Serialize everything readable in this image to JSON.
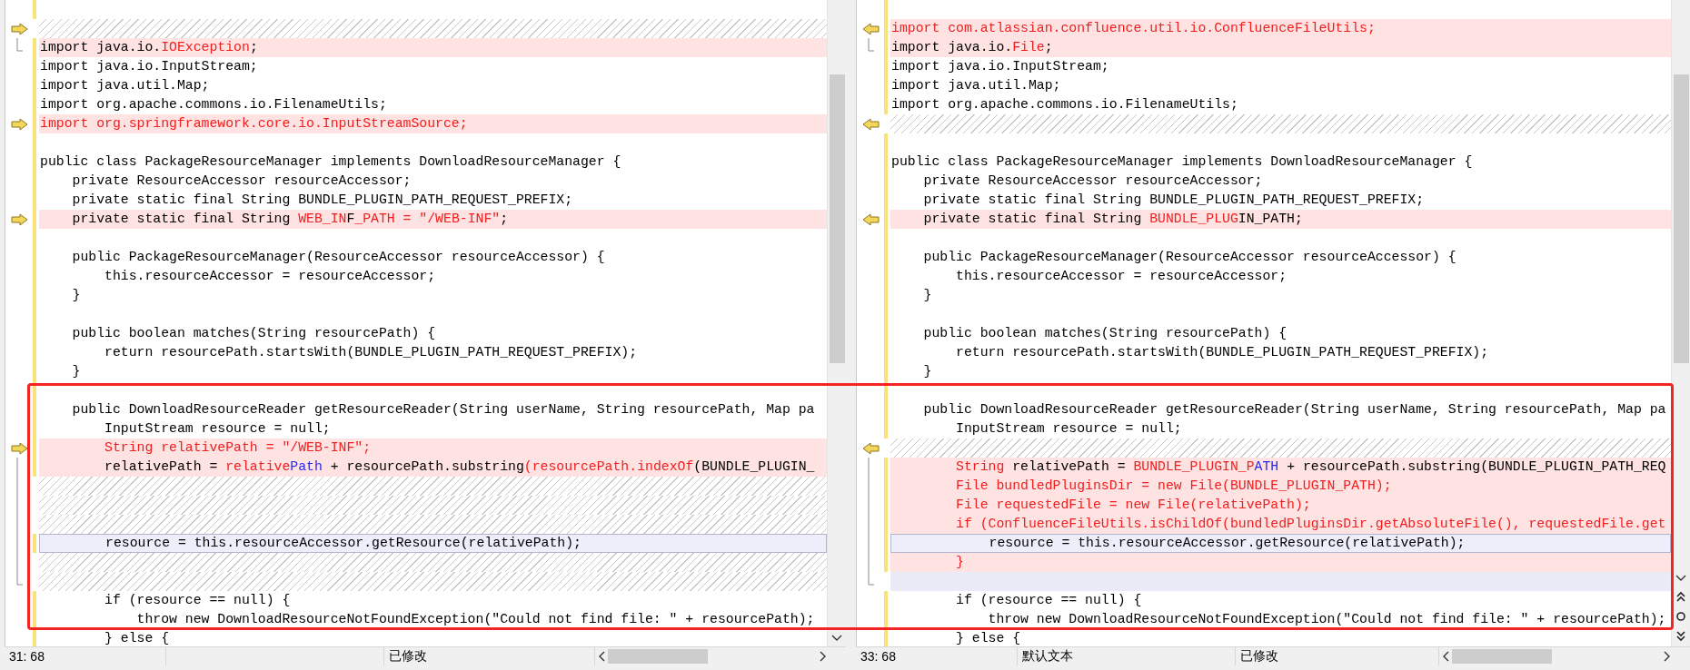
{
  "panes": [
    {
      "kind": "left",
      "lines": [
        {
          "kind": "empty",
          "arrow": false,
          "bracket": false
        },
        {
          "kind": "gap",
          "arrow": true,
          "bracket": false
        },
        {
          "kind": "changed",
          "arrow": false,
          "bracket": true,
          "segments": [
            {
              "text": "import java.io.",
              "color": "#000000"
            },
            {
              "text": "IOException",
              "color": "#f01e1e"
            },
            {
              "text": ";",
              "color": "#000000"
            }
          ]
        },
        {
          "kind": "same",
          "arrow": false,
          "bracket": false,
          "segments": [
            {
              "text": "import java.io.InputStream;",
              "color": "#000000"
            }
          ]
        },
        {
          "kind": "same",
          "arrow": false,
          "bracket": false,
          "segments": [
            {
              "text": "import java.util.Map;",
              "color": "#000000"
            }
          ]
        },
        {
          "kind": "same",
          "arrow": false,
          "bracket": false,
          "segments": [
            {
              "text": "import org.apache.commons.io.FilenameUtils;",
              "color": "#000000"
            }
          ]
        },
        {
          "kind": "changed",
          "arrow": true,
          "bracket": false,
          "segments": [
            {
              "text": "import org.springframework.core.io.InputStreamSource;",
              "color": "#f01e1e"
            }
          ]
        },
        {
          "kind": "empty",
          "arrow": false,
          "bracket": false
        },
        {
          "kind": "same",
          "arrow": false,
          "bracket": false,
          "segments": [
            {
              "text": "public class PackageResourceManager implements DownloadResourceManager {",
              "color": "#000000"
            }
          ]
        },
        {
          "kind": "same",
          "arrow": false,
          "bracket": false,
          "segments": [
            {
              "text": "    private ResourceAccessor resourceAccessor;",
              "color": "#000000"
            }
          ]
        },
        {
          "kind": "same",
          "arrow": false,
          "bracket": false,
          "segments": [
            {
              "text": "    private static final String BUNDLE_PLUGIN_PATH_REQUEST_PREFIX;",
              "color": "#000000"
            }
          ]
        },
        {
          "kind": "changed",
          "arrow": true,
          "bracket": false,
          "segments": [
            {
              "text": "    private static final String ",
              "color": "#000000"
            },
            {
              "text": "WEB_IN",
              "color": "#f01e1e"
            },
            {
              "text": "F",
              "color": "#000000"
            },
            {
              "text": "_PATH = \"/WEB-INF\"",
              "color": "#f01e1e"
            },
            {
              "text": ";",
              "color": "#000000"
            }
          ]
        },
        {
          "kind": "empty",
          "arrow": false,
          "bracket": false
        },
        {
          "kind": "same",
          "arrow": false,
          "bracket": false,
          "segments": [
            {
              "text": "    public PackageResourceManager(ResourceAccessor resourceAccessor) {",
              "color": "#000000"
            }
          ]
        },
        {
          "kind": "same",
          "arrow": false,
          "bracket": false,
          "segments": [
            {
              "text": "        this.resourceAccessor = resourceAccessor;",
              "color": "#000000"
            }
          ]
        },
        {
          "kind": "same",
          "arrow": false,
          "bracket": false,
          "segments": [
            {
              "text": "    }",
              "color": "#000000"
            }
          ]
        },
        {
          "kind": "empty",
          "arrow": false,
          "bracket": false
        },
        {
          "kind": "same",
          "arrow": false,
          "bracket": false,
          "segments": [
            {
              "text": "    public boolean matches(String resourcePath) {",
              "color": "#000000"
            }
          ]
        },
        {
          "kind": "same",
          "arrow": false,
          "bracket": false,
          "segments": [
            {
              "text": "        return resourcePath.startsWith(BUNDLE_PLUGIN_PATH_REQUEST_PREFIX);",
              "color": "#000000"
            }
          ]
        },
        {
          "kind": "same",
          "arrow": false,
          "bracket": false,
          "segments": [
            {
              "text": "    }",
              "color": "#000000"
            }
          ]
        },
        {
          "kind": "empty",
          "arrow": false,
          "bracket": false
        },
        {
          "kind": "same",
          "arrow": false,
          "bracket": false,
          "segments": [
            {
              "text": "    public DownloadResourceReader getResourceReader(String userName, String resourcePath, Map pa",
              "color": "#000000"
            }
          ]
        },
        {
          "kind": "same",
          "arrow": false,
          "bracket": false,
          "segments": [
            {
              "text": "        InputStream resource = null;",
              "color": "#000000"
            }
          ]
        },
        {
          "kind": "changed",
          "arrow": true,
          "bracket": false,
          "segments": [
            {
              "text": "        String relativePath = \"/WEB-INF\";",
              "color": "#f01e1e"
            }
          ]
        },
        {
          "kind": "changed",
          "arrow": false,
          "bracket": true,
          "segments": [
            {
              "text": "        relativePath = ",
              "color": "#000000"
            },
            {
              "text": "relative",
              "color": "#f01e1e"
            },
            {
              "text": "Path",
              "color": "#2828e6"
            },
            {
              "text": " + resourcePath.substring",
              "color": "#000000"
            },
            {
              "text": "(resourcePath.indexOf",
              "color": "#f01e1e"
            },
            {
              "text": "(BUNDLE_PLUGIN_",
              "color": "#000000"
            }
          ]
        },
        {
          "kind": "gap",
          "arrow": false,
          "bracket": true
        },
        {
          "kind": "gap",
          "arrow": false,
          "bracket": true
        },
        {
          "kind": "gap",
          "arrow": false,
          "bracket": true
        },
        {
          "kind": "current",
          "arrow": false,
          "bracket": true,
          "segments": [
            {
              "text": "        resource = this.resourceAccessor.getResource(relativePath);",
              "color": "#000000"
            }
          ]
        },
        {
          "kind": "gap",
          "arrow": false,
          "bracket": true
        },
        {
          "kind": "gap",
          "arrow": false,
          "bracket": true
        },
        {
          "kind": "same",
          "arrow": false,
          "bracket": false,
          "segments": [
            {
              "text": "        if (resource == null) {",
              "color": "#000000"
            }
          ]
        },
        {
          "kind": "same",
          "arrow": false,
          "bracket": false,
          "segments": [
            {
              "text": "            throw new DownloadResourceNotFoundException(\"Could not find file: \" + resourcePath);",
              "color": "#000000"
            }
          ]
        },
        {
          "kind": "same",
          "arrow": false,
          "bracket": false,
          "segments": [
            {
              "text": "        } else {",
              "color": "#000000"
            }
          ]
        }
      ],
      "status": {
        "position": "31: 68",
        "modified": "已修改"
      }
    },
    {
      "kind": "right",
      "lines": [
        {
          "kind": "empty",
          "arrow": false,
          "bracket": false
        },
        {
          "kind": "changed",
          "arrow": true,
          "bracket": false,
          "segments": [
            {
              "text": "import com.atlassian.confluence.util.io.ConfluenceFileUtils;",
              "color": "#f01e1e"
            }
          ]
        },
        {
          "kind": "changed",
          "arrow": false,
          "bracket": true,
          "segments": [
            {
              "text": "import java.io.",
              "color": "#000000"
            },
            {
              "text": "File",
              "color": "#f01e1e"
            },
            {
              "text": ";",
              "color": "#000000"
            }
          ]
        },
        {
          "kind": "same",
          "arrow": false,
          "bracket": false,
          "segments": [
            {
              "text": "import java.io.InputStream;",
              "color": "#000000"
            }
          ]
        },
        {
          "kind": "same",
          "arrow": false,
          "bracket": false,
          "segments": [
            {
              "text": "import java.util.Map;",
              "color": "#000000"
            }
          ]
        },
        {
          "kind": "same",
          "arrow": false,
          "bracket": false,
          "segments": [
            {
              "text": "import org.apache.commons.io.FilenameUtils;",
              "color": "#000000"
            }
          ]
        },
        {
          "kind": "gap",
          "arrow": true,
          "bracket": false
        },
        {
          "kind": "empty",
          "arrow": false,
          "bracket": false
        },
        {
          "kind": "same",
          "arrow": false,
          "bracket": false,
          "segments": [
            {
              "text": "public class PackageResourceManager implements DownloadResourceManager {",
              "color": "#000000"
            }
          ]
        },
        {
          "kind": "same",
          "arrow": false,
          "bracket": false,
          "segments": [
            {
              "text": "    private ResourceAccessor resourceAccessor;",
              "color": "#000000"
            }
          ]
        },
        {
          "kind": "same",
          "arrow": false,
          "bracket": false,
          "segments": [
            {
              "text": "    private static final String BUNDLE_PLUGIN_PATH_REQUEST_PREFIX;",
              "color": "#000000"
            }
          ]
        },
        {
          "kind": "changed",
          "arrow": true,
          "bracket": false,
          "segments": [
            {
              "text": "    private static final String ",
              "color": "#000000"
            },
            {
              "text": "BUNDLE_PLUG",
              "color": "#f01e1e"
            },
            {
              "text": "IN_PATH;",
              "color": "#000000"
            }
          ]
        },
        {
          "kind": "empty",
          "arrow": false,
          "bracket": false
        },
        {
          "kind": "same",
          "arrow": false,
          "bracket": false,
          "segments": [
            {
              "text": "    public PackageResourceManager(ResourceAccessor resourceAccessor) {",
              "color": "#000000"
            }
          ]
        },
        {
          "kind": "same",
          "arrow": false,
          "bracket": false,
          "segments": [
            {
              "text": "        this.resourceAccessor = resourceAccessor;",
              "color": "#000000"
            }
          ]
        },
        {
          "kind": "same",
          "arrow": false,
          "bracket": false,
          "segments": [
            {
              "text": "    }",
              "color": "#000000"
            }
          ]
        },
        {
          "kind": "empty",
          "arrow": false,
          "bracket": false
        },
        {
          "kind": "same",
          "arrow": false,
          "bracket": false,
          "segments": [
            {
              "text": "    public boolean matches(String resourcePath) {",
              "color": "#000000"
            }
          ]
        },
        {
          "kind": "same",
          "arrow": false,
          "bracket": false,
          "segments": [
            {
              "text": "        return resourcePath.startsWith(BUNDLE_PLUGIN_PATH_REQUEST_PREFIX);",
              "color": "#000000"
            }
          ]
        },
        {
          "kind": "same",
          "arrow": false,
          "bracket": false,
          "segments": [
            {
              "text": "    }",
              "color": "#000000"
            }
          ]
        },
        {
          "kind": "empty",
          "arrow": false,
          "bracket": false
        },
        {
          "kind": "same",
          "arrow": false,
          "bracket": false,
          "segments": [
            {
              "text": "    public DownloadResourceReader getResourceReader(String userName, String resourcePath, Map pa",
              "color": "#000000"
            }
          ]
        },
        {
          "kind": "same",
          "arrow": false,
          "bracket": false,
          "segments": [
            {
              "text": "        InputStream resource = null;",
              "color": "#000000"
            }
          ]
        },
        {
          "kind": "gap",
          "arrow": true,
          "bracket": false
        },
        {
          "kind": "changed",
          "arrow": false,
          "bracket": true,
          "segments": [
            {
              "text": "        String",
              "color": "#f01e1e"
            },
            {
              "text": " relativePath = ",
              "color": "#000000"
            },
            {
              "text": "BUNDLE_PLUGIN_P",
              "color": "#f01e1e"
            },
            {
              "text": "ATH",
              "color": "#2828e6"
            },
            {
              "text": " + resourcePath.substring(BUNDLE_PLUGIN_PATH_REQ",
              "color": "#000000"
            }
          ]
        },
        {
          "kind": "changed",
          "arrow": false,
          "bracket": true,
          "segments": [
            {
              "text": "        File bundledPluginsDir = new File(BUNDLE_PLUGIN_PATH);",
              "color": "#f01e1e"
            }
          ]
        },
        {
          "kind": "changed",
          "arrow": false,
          "bracket": true,
          "segments": [
            {
              "text": "        File requestedFile = new File(relativePath);",
              "color": "#f01e1e"
            }
          ]
        },
        {
          "kind": "changed",
          "arrow": false,
          "bracket": true,
          "segments": [
            {
              "text": "        if (ConfluenceFileUtils.isChildOf(bundledPluginsDir.getAbsoluteFile(), requestedFile.get",
              "color": "#f01e1e"
            }
          ]
        },
        {
          "kind": "current",
          "arrow": false,
          "bracket": true,
          "segments": [
            {
              "text": "            resource = this.resourceAccessor.getResource(relativePath);",
              "color": "#000000"
            }
          ]
        },
        {
          "kind": "changed",
          "arrow": false,
          "bracket": true,
          "segments": [
            {
              "text": "        }",
              "color": "#f01e1e"
            }
          ]
        },
        {
          "kind": "pending",
          "arrow": false,
          "bracket": true
        },
        {
          "kind": "same",
          "arrow": false,
          "bracket": false,
          "segments": [
            {
              "text": "        if (resource == null) {",
              "color": "#000000"
            }
          ]
        },
        {
          "kind": "same",
          "arrow": false,
          "bracket": false,
          "segments": [
            {
              "text": "            throw new DownloadResourceNotFoundException(\"Could not find file: \" + resourcePath);",
              "color": "#000000"
            }
          ]
        },
        {
          "kind": "same",
          "arrow": false,
          "bracket": false,
          "segments": [
            {
              "text": "        } else {",
              "color": "#000000"
            }
          ]
        }
      ],
      "status": {
        "position": "33: 68",
        "encoding": "默认文本",
        "modified": "已修改"
      }
    }
  ],
  "highlight_box": {
    "visible": true
  }
}
